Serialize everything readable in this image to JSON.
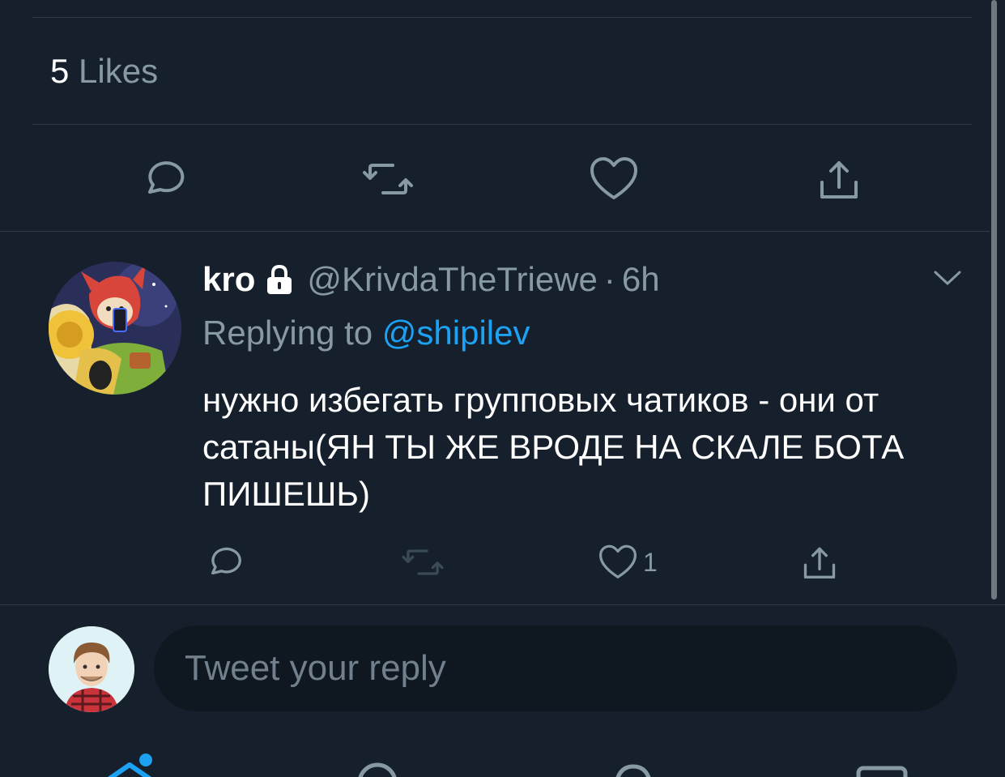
{
  "tweet": {
    "likes_count": "5",
    "likes_label": "Likes"
  },
  "actions": {
    "reply_icon": "reply-icon",
    "retweet_icon": "retweet-icon",
    "like_icon": "like-icon",
    "share_icon": "share-icon"
  },
  "reply": {
    "display_name": "kro",
    "lock_icon": "lock-icon",
    "handle": "@KrivdaTheTriewe",
    "separator": "·",
    "time": "6h",
    "replying_to_label": "Replying to",
    "replying_to_handle": "@shipilev",
    "text": "нужно избегать групповых чатиков - они от сатаны(ЯН ТЫ ЖЕ ВРОДЕ НА СКАЛЕ БОТА ПИШЕШЬ)",
    "like_count": "1",
    "menu_icon": "chevron-down-icon"
  },
  "compose": {
    "placeholder": "Tweet your reply"
  },
  "colors": {
    "background": "#16202c",
    "muted": "#8899a6",
    "accent": "#1da1f2",
    "divider": "#2f3b48"
  }
}
